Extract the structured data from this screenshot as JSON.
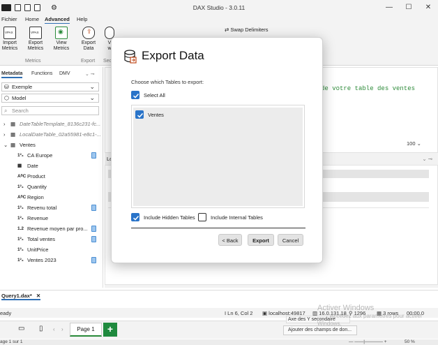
{
  "window": {
    "title": "DAX Studio - 3.0.11"
  },
  "ribbon": {
    "tabs": [
      "Fichier",
      "Home",
      "Advanced",
      "Help"
    ],
    "active_tab": "Advanced",
    "buttons": [
      {
        "label": "Import\nMetrics",
        "icon": "import-vpax-icon"
      },
      {
        "label": "Export\nMetrics",
        "icon": "export-vpax-icon"
      },
      {
        "label": "View\nMetrics",
        "icon": "view-metrics-icon"
      },
      {
        "label": "Export\nData",
        "icon": "export-data-icon"
      },
      {
        "label": "V\nw",
        "icon": "view-as-icon"
      }
    ],
    "groups": [
      "Metrics",
      "Export",
      "Sec"
    ],
    "swap_delimiters": "Swap Delimiters"
  },
  "left_panel": {
    "tabs": [
      "Metadata",
      "Functions",
      "DMV"
    ],
    "active_tab": "Metadata",
    "database": "Exemple",
    "model": "Model",
    "search_placeholder": "Search",
    "tree": [
      {
        "label": "DateTableTemplate_8136c231-fc...",
        "type": "table",
        "italic": true,
        "expanded": false
      },
      {
        "label": "LocalDateTable_02a55981-e8c1-...",
        "type": "table",
        "italic": true,
        "expanded": false
      },
      {
        "label": "Ventes",
        "type": "table",
        "italic": false,
        "expanded": true
      },
      {
        "label": "CA Europe",
        "type": "123",
        "measure": true
      },
      {
        "label": "Date",
        "type": "date",
        "measure": false
      },
      {
        "label": "Product",
        "type": "abc",
        "measure": false
      },
      {
        "label": "Quantity",
        "type": "123",
        "measure": false
      },
      {
        "label": "Region",
        "type": "abc",
        "measure": false
      },
      {
        "label": "Revenu total",
        "type": "123",
        "measure": true
      },
      {
        "label": "Revenue",
        "type": "123",
        "measure": false
      },
      {
        "label": "Revenue moyen par pro...",
        "type": "1.2",
        "measure": true
      },
      {
        "label": "Total ventes",
        "type": "123",
        "measure": true
      },
      {
        "label": "UnitPrice",
        "type": "123",
        "measure": false
      },
      {
        "label": "Ventes 2023",
        "type": "123",
        "measure": true
      }
    ]
  },
  "editor": {
    "code_fragment": "de votre table des ventes",
    "zoom": "100",
    "results_tab_fragment": "Lo"
  },
  "document_tab": {
    "label": "Query1.dax*"
  },
  "status_bar": {
    "left": "eady",
    "position": "Ln 6, Col 2",
    "server": "localhost:49817",
    "version": "16.0.131.18",
    "spid": "1296",
    "rows": "3 rows",
    "time": "00:00.0"
  },
  "page_bar": {
    "page_label": "Page 1",
    "add_label": "+",
    "footer_left": "age 1 sur 1",
    "footer_zoom": "50 %"
  },
  "watermark": {
    "line1": "Activer Windows",
    "line2": "Accédez aux paramètres pour activer",
    "line3": "Windows."
  },
  "ghost_panel": {
    "item1": "Axe des Y secondaire",
    "item2": "Ajouter des champs de don..."
  },
  "dialog": {
    "title": "Export Data",
    "prompt": "Choose which Tables to export:",
    "select_all_label": "Select All",
    "select_all_checked": true,
    "tables": [
      {
        "name": "Ventes",
        "checked": true
      }
    ],
    "include_hidden_label": "Include Hidden Tables",
    "include_hidden_checked": true,
    "include_internal_label": "Include Internal Tables",
    "include_internal_checked": false,
    "back_label": "< Back",
    "export_label": "Export",
    "cancel_label": "Cancel"
  },
  "colors": {
    "accent": "#2a74c9",
    "code_green": "#2e8b3a",
    "page_green": "#1f8a3e"
  }
}
